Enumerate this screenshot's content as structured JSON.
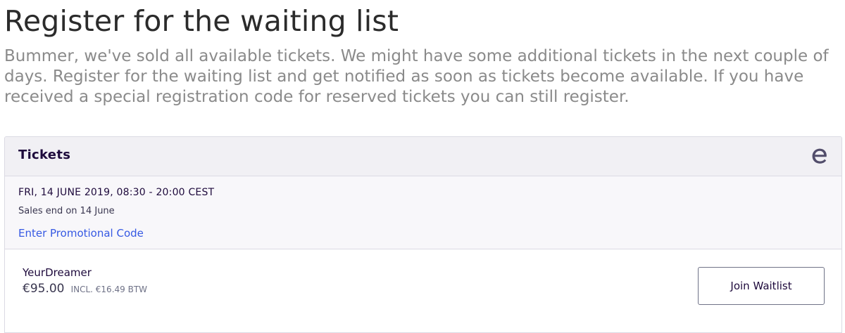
{
  "page": {
    "title": "Register for the waiting list",
    "intro": "Bummer, we've sold all available tickets. We might have some additional tickets in the next couple of days. Register for the waiting list and get notified as soon as tickets become available. If you have received a special registration code for reserved tickets you can still register."
  },
  "tickets_panel": {
    "title": "Tickets",
    "brand_icon": "eventbrite-e-logo-icon",
    "event_date": "FRI, 14 JUNE 2019, 08:30 - 20:00 CEST",
    "sales_end": "Sales end on 14 June",
    "promo_link": "Enter Promotional Code",
    "ticket": {
      "name": "YeurDreamer",
      "price": "€95.00",
      "tax": "INCL. €16.49 BTW",
      "button_label": "Join Waitlist"
    }
  },
  "colors": {
    "title_text": "#2b2b2b",
    "intro_text": "#8a8a8a",
    "panel_header_bg": "#f1f0f4",
    "panel_bg": "#f8f7fa",
    "link": "#3659e3",
    "dark_text": "#1e0a3c"
  }
}
